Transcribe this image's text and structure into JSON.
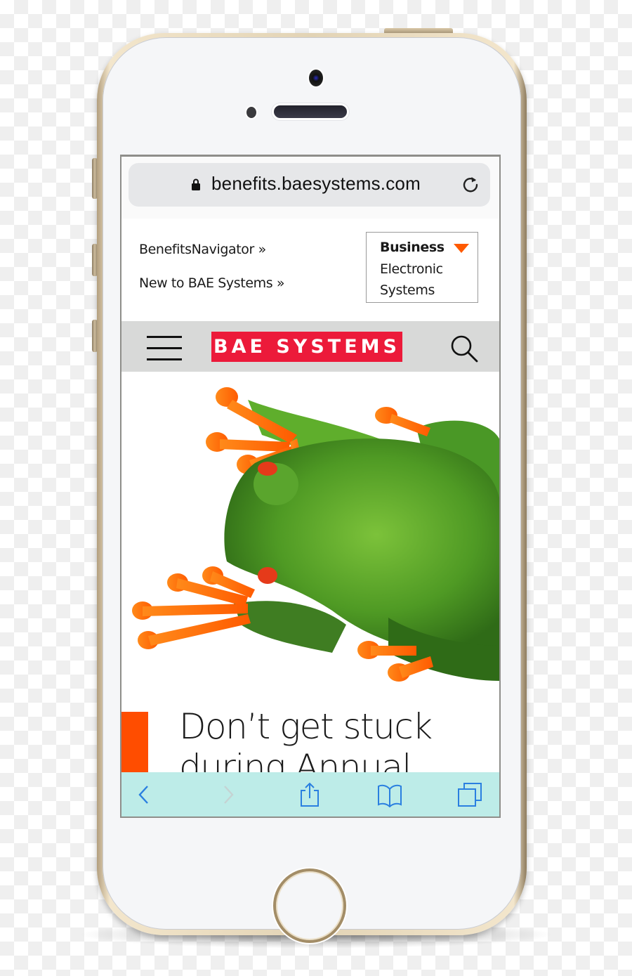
{
  "device": {
    "name": "iPhone (gold)"
  },
  "browser": {
    "url": "benefits.baesystems.com",
    "icons": {
      "lock": "lock-icon",
      "reload": "reload-icon"
    }
  },
  "topnav": {
    "links": [
      {
        "label": "BenefitsNavigator »"
      },
      {
        "label": "New to BAE Systems »"
      }
    ],
    "business_select": {
      "lines": [
        "Business",
        "Electronic",
        "Systems"
      ],
      "icon": "triangle-down-icon",
      "accent": "#ff5a00"
    }
  },
  "header": {
    "menu_icon": "hamburger-icon",
    "logo_text": "BAE SYSTEMS",
    "logo_color": "#ec1a3a",
    "search_icon": "search-icon"
  },
  "hero": {
    "image": "red-eyed tree frog photo",
    "headline_lines": [
      "Don’t get stuck",
      "during Annual"
    ],
    "accent_color": "#ff4d00"
  },
  "toolbar": {
    "background": "#bdece8",
    "buttons": [
      {
        "name": "back",
        "icon": "chevron-left-icon",
        "enabled": true
      },
      {
        "name": "forward",
        "icon": "chevron-right-icon",
        "enabled": false
      },
      {
        "name": "share",
        "icon": "share-icon",
        "enabled": true
      },
      {
        "name": "bookmarks",
        "icon": "book-icon",
        "enabled": true
      },
      {
        "name": "tabs",
        "icon": "tabs-icon",
        "enabled": true
      }
    ],
    "active_color": "#2a7fe0",
    "disabled_color": "#c5d3d3"
  }
}
